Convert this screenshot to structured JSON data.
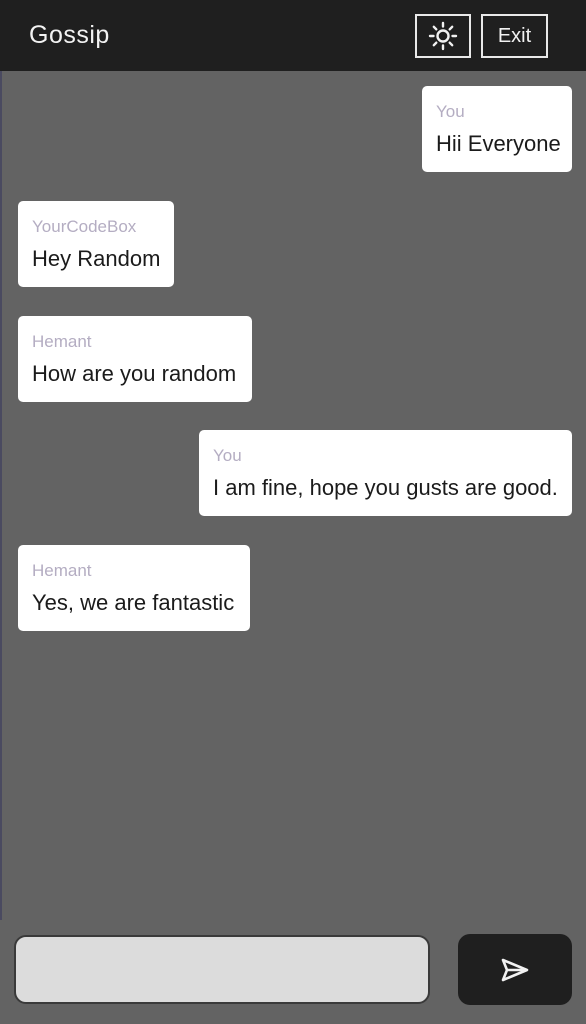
{
  "header": {
    "title": "Gossip",
    "theme_icon": "sun-icon",
    "exit_label": "Exit"
  },
  "messages": [
    {
      "sender": "You",
      "text": "Hii Everyone",
      "side": "right"
    },
    {
      "sender": "YourCodeBox",
      "text": "Hey Random",
      "side": "left"
    },
    {
      "sender": "Hemant",
      "text": "How are you random",
      "side": "left"
    },
    {
      "sender": "You",
      "text": "I am fine, hope you gusts are good.",
      "side": "right"
    },
    {
      "sender": "Hemant",
      "text": "Yes, we are fantastic",
      "side": "left"
    }
  ],
  "composer": {
    "value": "",
    "placeholder": "",
    "send_icon": "send-icon"
  },
  "colors": {
    "header_bg": "#1f1f1f",
    "chat_bg": "#636363",
    "bubble_bg": "#ffffff",
    "sender_text": "#b4adc2",
    "input_bg": "#dcdcdc",
    "send_bg": "#1f1f1f"
  }
}
